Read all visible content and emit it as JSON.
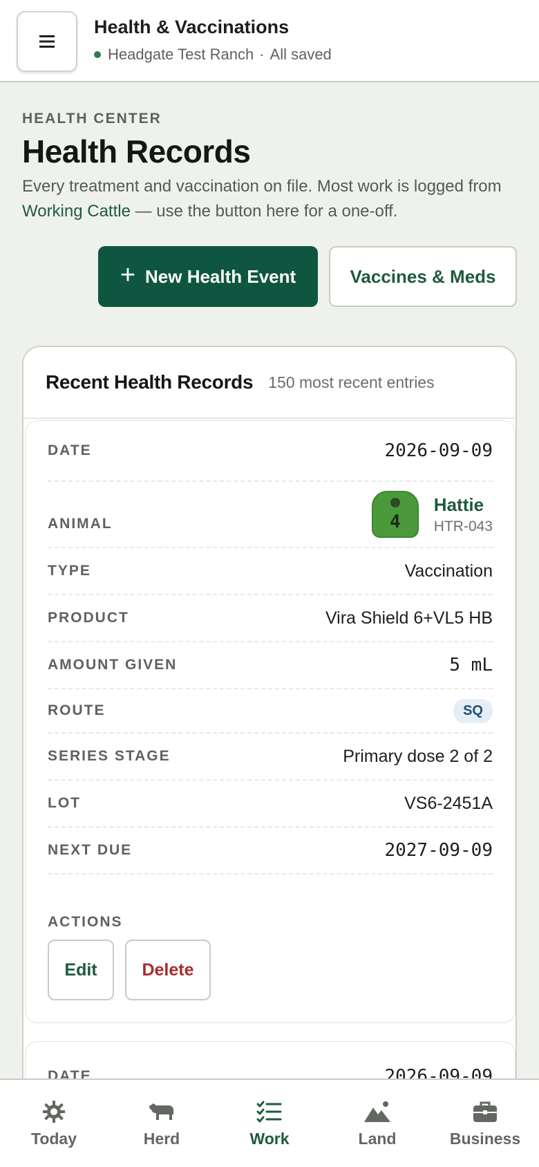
{
  "header": {
    "title": "Health & Vaccinations",
    "ranch": "Headgate Test Ranch",
    "separator": "·",
    "save_status": "All saved"
  },
  "page": {
    "eyebrow": "HEALTH CENTER",
    "title": "Health Records",
    "desc_before": "Every treatment and vaccination on file. Most work is logged from ",
    "desc_link": "Working Cattle",
    "desc_after": " — use the button here for a one-off.",
    "new_event_label": "New Health Event",
    "vaccines_label": "Vaccines & Meds"
  },
  "card": {
    "title": "Recent Health Records",
    "subtitle": "150 most recent entries"
  },
  "labels": {
    "date": "DATE",
    "animal": "ANIMAL",
    "type": "TYPE",
    "product": "PRODUCT",
    "amount": "AMOUNT GIVEN",
    "route": "ROUTE",
    "series": "SERIES STAGE",
    "lot": "LOT",
    "next_due": "NEXT DUE",
    "actions": "ACTIONS",
    "edit": "Edit",
    "delete": "Delete"
  },
  "records": [
    {
      "date": "2026-09-09",
      "tag_number": "4",
      "tag_color": "#4a9a3c",
      "animal_name": "Hattie",
      "animal_id": "HTR-043",
      "type": "Vaccination",
      "product": "Vira Shield 6+VL5 HB",
      "amount": "5 mL",
      "route": "SQ",
      "series": "Primary dose 2 of 2",
      "lot": "VS6-2451A",
      "next_due": "2027-09-09"
    },
    {
      "date": "2026-09-09"
    }
  ],
  "nav": [
    {
      "label": "Today",
      "icon": "gear-icon"
    },
    {
      "label": "Herd",
      "icon": "cow-icon"
    },
    {
      "label": "Work",
      "icon": "checklist-icon",
      "active": true
    },
    {
      "label": "Land",
      "icon": "mountain-icon"
    },
    {
      "label": "Business",
      "icon": "briefcase-icon"
    }
  ],
  "colors": {
    "brand": "#0f5640",
    "accent_text": "#1f5a3d",
    "danger": "#a62c2c",
    "background": "#eff1ed"
  }
}
